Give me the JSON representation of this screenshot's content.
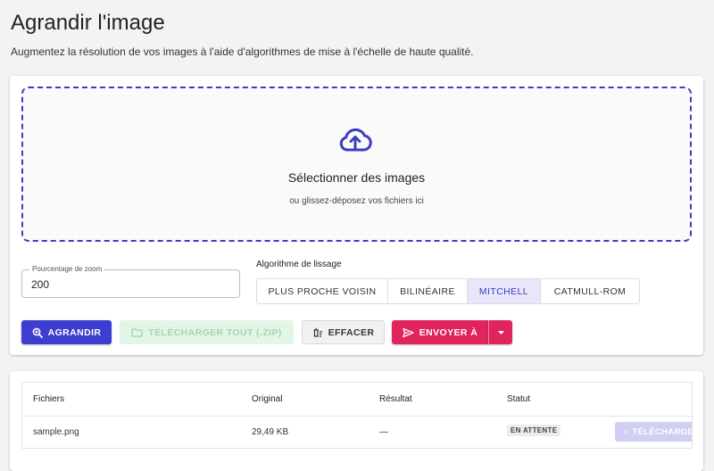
{
  "page": {
    "title": "Agrandir l'image",
    "subtitle": "Augmentez la résolution de vos images à l'aide d'algorithmes de mise à l'échelle de haute qualité."
  },
  "dropzone": {
    "icon": "cloud-upload-icon",
    "title": "Sélectionner des images",
    "hint": "ou glissez-déposez vos fichiers ici"
  },
  "zoom": {
    "label": "Pourcentage de zoom",
    "value": "200"
  },
  "algorithm": {
    "label": "Algorithme de lissage",
    "options": [
      "PLUS PROCHE VOISIN",
      "BILINÉAIRE",
      "MITCHELL",
      "CATMULL-ROM"
    ],
    "selected": "MITCHELL"
  },
  "actions": {
    "upscale": "AGRANDIR",
    "download_all": "TÉLÉCHARGER TOUT (.ZIP)",
    "clear": "EFFACER",
    "send_to": "ENVOYER À"
  },
  "table": {
    "headers": [
      "Fichiers",
      "Original",
      "Résultat",
      "Statut"
    ],
    "rows": [
      {
        "file": "sample.png",
        "original": "29,49 KB",
        "result": "—",
        "status": "EN ATTENTE",
        "download_label": "TÉLÉCHARGER"
      }
    ]
  },
  "colors": {
    "primary": "#3d3dcf",
    "accent": "#e0245e",
    "selected_bg": "#e9e6fb",
    "disabled_green": "#e3f5e6"
  }
}
